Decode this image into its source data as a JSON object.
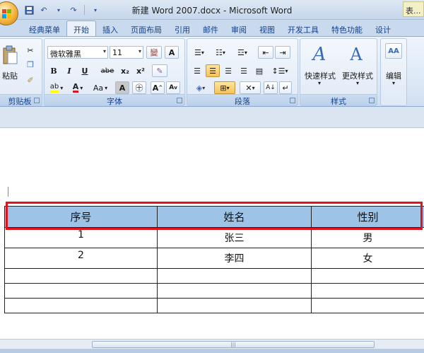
{
  "window": {
    "title": "新建 Word 2007.docx - Microsoft Word",
    "corner_text": "表..."
  },
  "tabs": [
    {
      "label": "经典菜单",
      "active": false
    },
    {
      "label": "开始",
      "active": true
    },
    {
      "label": "插入",
      "active": false
    },
    {
      "label": "页面布局",
      "active": false
    },
    {
      "label": "引用",
      "active": false
    },
    {
      "label": "邮件",
      "active": false
    },
    {
      "label": "审阅",
      "active": false
    },
    {
      "label": "视图",
      "active": false
    },
    {
      "label": "开发工具",
      "active": false
    },
    {
      "label": "特色功能",
      "active": false
    },
    {
      "label": "设计",
      "active": false
    }
  ],
  "ribbon": {
    "clipboard": {
      "label": "剪贴板",
      "paste_label": "粘贴"
    },
    "font": {
      "label": "字体",
      "font_name": "微软雅黑",
      "font_size": "11",
      "wen_glyph": "變",
      "a_glyph": "A",
      "bold": "B",
      "italic": "I",
      "underline": "U",
      "strike": "abe",
      "sub": "x₂",
      "sup": "x²",
      "aa": "Aa",
      "grow": "A",
      "shrink": "A"
    },
    "paragraph": {
      "label": "段落"
    },
    "styles": {
      "label": "样式",
      "quick_styles": "快速样式",
      "change_styles": "更改样式"
    },
    "editing": {
      "label": "编辑"
    }
  },
  "table": {
    "headers": [
      "序号",
      "姓名",
      "性别"
    ],
    "rows": [
      [
        "1",
        "张三",
        "男"
      ],
      [
        "2",
        "李四",
        "女"
      ],
      [
        "",
        "",
        ""
      ],
      [
        "",
        "",
        ""
      ],
      [
        "",
        "",
        ""
      ]
    ]
  },
  "colors": {
    "header_fill": "#9dc3e6",
    "highlight": "#e0141e"
  }
}
